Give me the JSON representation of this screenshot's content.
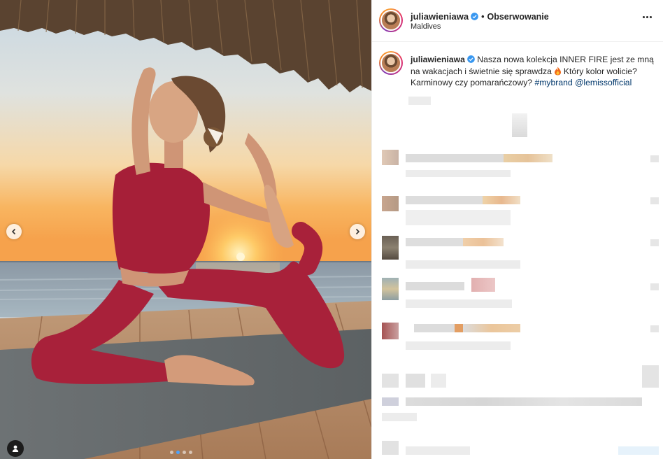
{
  "post": {
    "username": "juliawieniawa",
    "separator": "•",
    "follow_label": "Obserwowanie",
    "location": "Maldives",
    "caption_main": "Nasza nowa kolekcja INNER FIRE jest ze mną na wakacjach i świetnie się sprawdza",
    "caption_question": "Który kolor wolicie? Karminowy czy pomarańczowy?",
    "hashtag": "#mybrand",
    "mention": "@lemissofficial"
  },
  "carousel": {
    "slide_count": 4,
    "active_slide": 2
  },
  "icons": {
    "verified": "verified-badge-icon",
    "flame": "fire-emoji-icon",
    "prev": "chevron-left-icon",
    "next": "chevron-right-icon",
    "more": "more-options-icon",
    "tag": "user-tag-icon"
  },
  "colors": {
    "verified_blue": "#3897f0",
    "link": "#00376b",
    "leggings_red": "#a8213a",
    "sunset_orange": "#f7a646"
  }
}
